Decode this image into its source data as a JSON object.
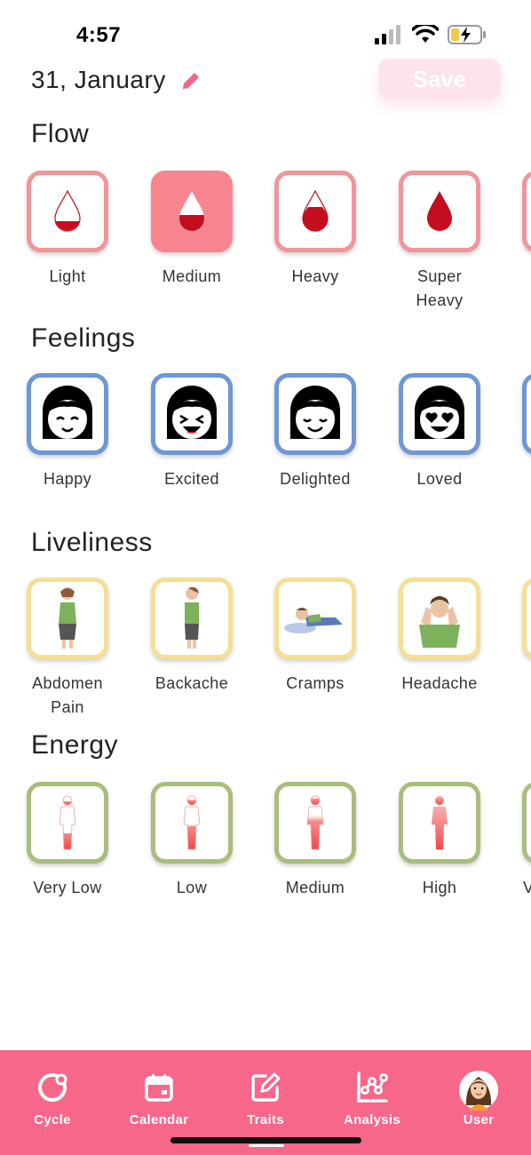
{
  "status_bar": {
    "time": "4:57"
  },
  "header": {
    "date": "31, January",
    "save_label": "Save"
  },
  "sections": {
    "flow": {
      "title": "Flow",
      "items": [
        {
          "label": "Light",
          "selected": false
        },
        {
          "label": "Medium",
          "selected": true
        },
        {
          "label": "Heavy",
          "selected": false
        },
        {
          "label": "Super\nHeavy",
          "selected": false
        }
      ]
    },
    "feelings": {
      "title": "Feelings",
      "items": [
        {
          "label": "Happy"
        },
        {
          "label": "Excited"
        },
        {
          "label": "Delighted"
        },
        {
          "label": "Loved"
        }
      ]
    },
    "liveliness": {
      "title": "Liveliness",
      "items": [
        {
          "label": "Abdomen\nPain"
        },
        {
          "label": "Backache"
        },
        {
          "label": "Cramps"
        },
        {
          "label": "Headache"
        }
      ]
    },
    "energy": {
      "title": "Energy",
      "items": [
        {
          "label": "Very Low"
        },
        {
          "label": "Low"
        },
        {
          "label": "Medium"
        },
        {
          "label": "High"
        },
        {
          "label": "V"
        }
      ]
    }
  },
  "tab_bar": {
    "tabs": [
      {
        "label": "Cycle",
        "icon": "cycle-icon"
      },
      {
        "label": "Calendar",
        "icon": "calendar-icon"
      },
      {
        "label": "Traits",
        "icon": "traits-edit-icon"
      },
      {
        "label": "Analysis",
        "icon": "analysis-chart-icon"
      },
      {
        "label": "User",
        "icon": "user-avatar"
      }
    ]
  },
  "colors": {
    "accent": "#f7678a",
    "flow_border": "#f0959c",
    "feelings_border": "#6f97d4",
    "liveliness_border": "#f5df93",
    "energy_border": "#a9bd7d",
    "blood": "#c40d1e"
  }
}
